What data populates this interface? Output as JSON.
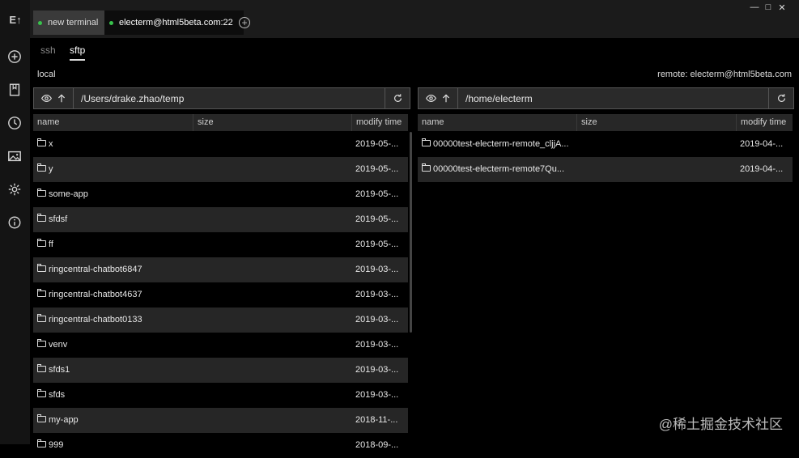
{
  "app": {
    "logo_text": "E↑"
  },
  "tabs": [
    {
      "label": "new terminal",
      "status_color": "#38c24c"
    },
    {
      "label": "electerm@html5beta.com:22",
      "status_color": "#38c24c"
    }
  ],
  "add_tab_label": "+",
  "window_controls": {
    "minimize": "—",
    "maximize": "□",
    "close": "✕"
  },
  "sidebar_icons": [
    "plus-circle-icon",
    "bookmark-icon",
    "history-icon",
    "image-icon",
    "gear-icon",
    "info-icon"
  ],
  "protocols": {
    "ssh": "ssh",
    "sftp": "sftp"
  },
  "local": {
    "label": "local",
    "path": "/Users/drake.zhao/temp",
    "columns": {
      "name": "name",
      "size": "size",
      "modified": "modify time"
    },
    "files": [
      {
        "name": "x",
        "modified": "2019-05-..."
      },
      {
        "name": "y",
        "modified": "2019-05-..."
      },
      {
        "name": "some-app",
        "modified": "2019-05-..."
      },
      {
        "name": "sfdsf",
        "modified": "2019-05-..."
      },
      {
        "name": "ff",
        "modified": "2019-05-..."
      },
      {
        "name": "ringcentral-chatbot6847",
        "modified": "2019-03-..."
      },
      {
        "name": "ringcentral-chatbot4637",
        "modified": "2019-03-..."
      },
      {
        "name": "ringcentral-chatbot0133",
        "modified": "2019-03-..."
      },
      {
        "name": "venv",
        "modified": "2019-03-..."
      },
      {
        "name": "sfds1",
        "modified": "2019-03-..."
      },
      {
        "name": "sfds",
        "modified": "2019-03-..."
      },
      {
        "name": "my-app",
        "modified": "2018-11-..."
      },
      {
        "name": "999",
        "modified": "2018-09-..."
      }
    ]
  },
  "remote": {
    "label": "remote: electerm@html5beta.com",
    "path": "/home/electerm",
    "columns": {
      "name": "name",
      "size": "size",
      "modified": "modify time"
    },
    "files": [
      {
        "name": "00000test-electerm-remote_cljjA...",
        "modified": "2019-04-..."
      },
      {
        "name": "00000test-electerm-remote7Qu...",
        "modified": "2019-04-..."
      }
    ]
  },
  "watermark": "@稀土掘金技术社区"
}
